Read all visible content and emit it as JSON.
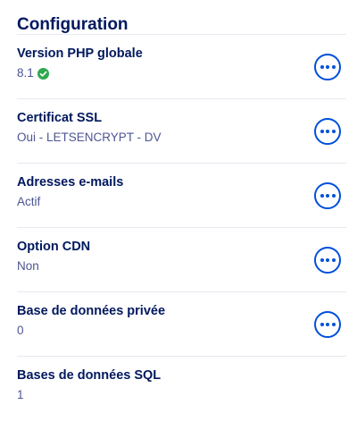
{
  "title": "Configuration",
  "rows": [
    {
      "label": "Version PHP globale",
      "value": "8.1",
      "status_icon": "check-circle-icon",
      "has_menu": true,
      "menu_icon": "more-horizontal-icon"
    },
    {
      "label": "Certificat SSL",
      "value": "Oui - LETSENCRYPT - DV",
      "has_menu": true,
      "menu_icon": "more-horizontal-icon"
    },
    {
      "label": "Adresses e-mails",
      "value": "Actif",
      "has_menu": true,
      "menu_icon": "more-horizontal-icon"
    },
    {
      "label": "Option CDN",
      "value": "Non",
      "has_menu": true,
      "menu_icon": "more-horizontal-icon"
    },
    {
      "label": "Base de données privée",
      "value": "0",
      "has_menu": true,
      "menu_icon": "more-horizontal-icon"
    },
    {
      "label": "Bases de données SQL",
      "value": "1",
      "has_menu": false
    }
  ],
  "colors": {
    "title": "#00185e",
    "label": "#00185e",
    "value": "#4d5693",
    "accent": "#0050d7",
    "success": "#2fa84f",
    "divider": "#e6e9f0"
  }
}
